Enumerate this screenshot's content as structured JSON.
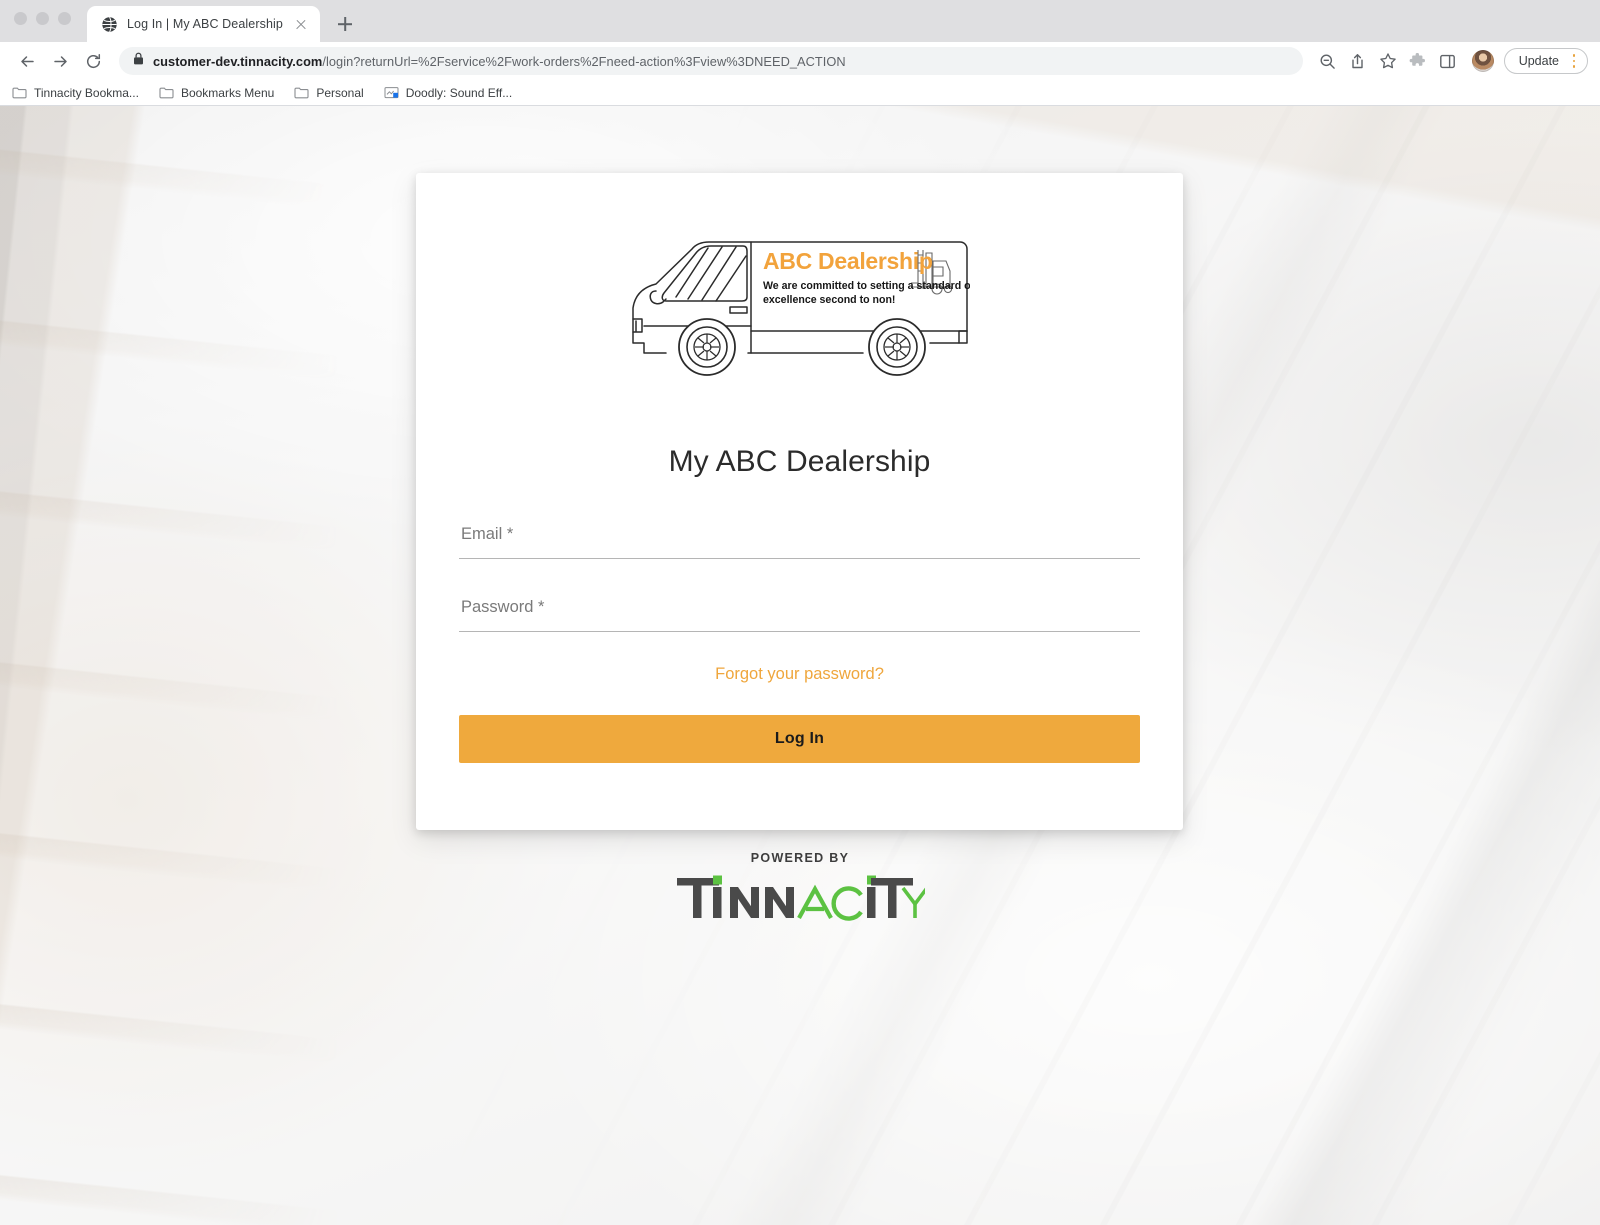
{
  "browser": {
    "tab": {
      "title": "Log In | My ABC Dealership",
      "favicon_name": "globe-icon",
      "close_name": "close-tab-icon"
    },
    "new_tab_label": "+",
    "nav": {
      "back": "Back",
      "forward": "Forward",
      "reload": "Reload"
    },
    "omnibox": {
      "lock": "lock-icon",
      "host": "customer-dev.tinnacity.com",
      "path": "/login?returnUrl=%2Fservice%2Fwork-orders%2Fneed-action%3Fview%3DNEED_ACTION",
      "full_url": "customer-dev.tinnacity.com/login?returnUrl=%2Fservice%2Fwork-orders%2Fneed-action%3Fview%3DNEED_ACTION"
    },
    "toolbar_icons": [
      "zoom-icon",
      "share-icon",
      "bookmark-star-icon",
      "extensions-puzzle-icon",
      "side-panel-icon"
    ],
    "avatar_name": "profile-avatar",
    "update_label": "Update",
    "kebab_name": "chrome-menu-icon",
    "bookmarks": [
      {
        "label": "Tinnacity Bookma...",
        "icon": "folder-icon"
      },
      {
        "label": "Bookmarks Menu",
        "icon": "folder-icon"
      },
      {
        "label": "Personal",
        "icon": "folder-icon"
      },
      {
        "label": "Doodly: Sound Eff...",
        "icon": "page-icon"
      }
    ]
  },
  "login": {
    "logo": {
      "brand": "ABC Dealership",
      "tagline_line1": "We are committed to setting a standard of",
      "tagline_line2": "excellence second to non!",
      "brand_color": "#F2A33C"
    },
    "title": "My ABC Dealership",
    "fields": [
      {
        "name": "email",
        "placeholder": "Email *",
        "value": "",
        "type": "text"
      },
      {
        "name": "password",
        "placeholder": "Password *",
        "value": "",
        "type": "password"
      }
    ],
    "forgot_password": "Forgot your password?",
    "submit_label": "Log In",
    "accent_color": "#EFA93D"
  },
  "footer": {
    "powered_by": "POWERED BY",
    "brand_parts": [
      {
        "text": "T",
        "color": "#4a4a4a"
      },
      {
        "text": "I",
        "color": "#4a4a4a"
      },
      {
        "text": "NN",
        "color": "#4a4a4a"
      },
      {
        "text": "ac",
        "color": "#5cc242"
      },
      {
        "text": "IT",
        "color": "#4a4a4a"
      },
      {
        "text": "Y",
        "color": "#5cc242"
      }
    ],
    "brand_full": "TINNACITY",
    "green": "#5CC242",
    "dark": "#4A4A4A"
  }
}
